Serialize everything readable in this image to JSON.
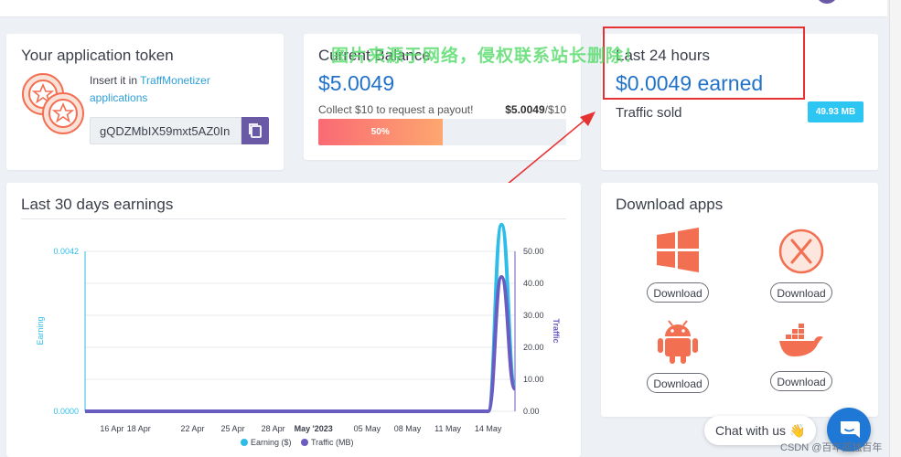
{
  "token_card": {
    "title": "Your application token",
    "help_prefix": "Insert it in",
    "help_link": "TraffMonetizer applications",
    "token_value": "gQDZMbIX59mxt5AZ0In",
    "copy_icon": "copy-icon",
    "coins_icon": "coins-icon"
  },
  "balance_card": {
    "title": "Current Balance",
    "amount": "$5.0049",
    "collect_text": "Collect $10 to request a payout!",
    "collect_current": "$5.0049",
    "collect_target": "/$10",
    "progress_label": "50%",
    "progress_value": 0.5
  },
  "day_card": {
    "title": "Last 24 hours",
    "earned": "$0.0049 earned",
    "traffic_label": "Traffic sold",
    "traffic_value": "49.93 MB"
  },
  "watermark": "图片来源于网络，侵权联系站长删除！",
  "earnings_card": {
    "title": "Last 30 days earnings"
  },
  "chart_data": {
    "type": "area",
    "title": "Last 30 days earnings",
    "x": [
      "2023-04-14",
      "2023-04-15",
      "2023-04-16",
      "2023-04-17",
      "2023-04-18",
      "2023-04-19",
      "2023-04-20",
      "2023-04-21",
      "2023-04-22",
      "2023-04-23",
      "2023-04-24",
      "2023-04-25",
      "2023-04-26",
      "2023-04-27",
      "2023-04-28",
      "2023-04-29",
      "2023-04-30",
      "2023-05-01",
      "2023-05-02",
      "2023-05-03",
      "2023-05-04",
      "2023-05-05",
      "2023-05-06",
      "2023-05-07",
      "2023-05-08",
      "2023-05-09",
      "2023-05-10",
      "2023-05-11",
      "2023-05-12",
      "2023-05-13",
      "2023-05-14",
      "2023-05-15",
      "2023-05-16"
    ],
    "x_ticks": [
      "16 Apr",
      "18 Apr",
      "22 Apr",
      "25 Apr",
      "28 Apr",
      "May '2023",
      "05 May",
      "08 May",
      "11 May",
      "14 May"
    ],
    "x_tick_dates": [
      "2023-04-16",
      "2023-04-18",
      "2023-04-22",
      "2023-04-25",
      "2023-04-28",
      "2023-05-01",
      "2023-05-05",
      "2023-05-08",
      "2023-05-11",
      "2023-05-14"
    ],
    "bold_tick": "May '2023",
    "xlim": [
      "2023-04-14",
      "2023-05-16"
    ],
    "series": [
      {
        "name": "Earning ($)",
        "axis": "left",
        "color": "#2dbde8",
        "values": [
          0,
          0,
          0,
          0,
          0,
          0,
          0,
          0,
          0,
          0,
          0,
          0,
          0,
          0,
          0,
          0,
          0,
          0,
          0,
          0,
          0,
          0,
          0,
          0,
          0,
          0,
          0,
          0,
          0,
          0,
          0,
          0.0049,
          0.0007
        ]
      },
      {
        "name": "Traffic (MB)",
        "axis": "right",
        "color": "#6a5cc0",
        "values": [
          0,
          0,
          0,
          0,
          0,
          0,
          0,
          0,
          0,
          0,
          0,
          0,
          0,
          0,
          0,
          0,
          0,
          0,
          0,
          0,
          0,
          0,
          0,
          0,
          0,
          0,
          0,
          0,
          0,
          0,
          0,
          42,
          7
        ]
      }
    ],
    "y_left": {
      "label": "Earning",
      "ticks": [
        "0.0042",
        "0.0000"
      ],
      "ylim": [
        0,
        0.0042
      ]
    },
    "y_right": {
      "label": "Traffic",
      "ticks": [
        "50.00",
        "40.00",
        "30.00",
        "20.00",
        "10.00",
        "0.00"
      ],
      "ylim": [
        0,
        50
      ]
    },
    "grid": true,
    "legend": "bottom"
  },
  "apps_card": {
    "title": "Download apps",
    "apps": [
      {
        "icon": "windows-icon",
        "label": "Download"
      },
      {
        "icon": "macos-icon",
        "label": "Download"
      },
      {
        "icon": "android-icon",
        "label": "Download"
      },
      {
        "icon": "docker-icon",
        "label": "Download"
      }
    ]
  },
  "chat": {
    "label": "Chat with us",
    "emoji": "👋",
    "fab_icon": "chat-bubble-icon"
  },
  "credit": "CSDN @百年孤独百年",
  "colors": {
    "accent_blue": "#2272c8",
    "purple": "#6a5aa6",
    "orange": "#f36f52",
    "badge_cyan": "#2dc5f2",
    "annotation_red": "#e63232"
  }
}
